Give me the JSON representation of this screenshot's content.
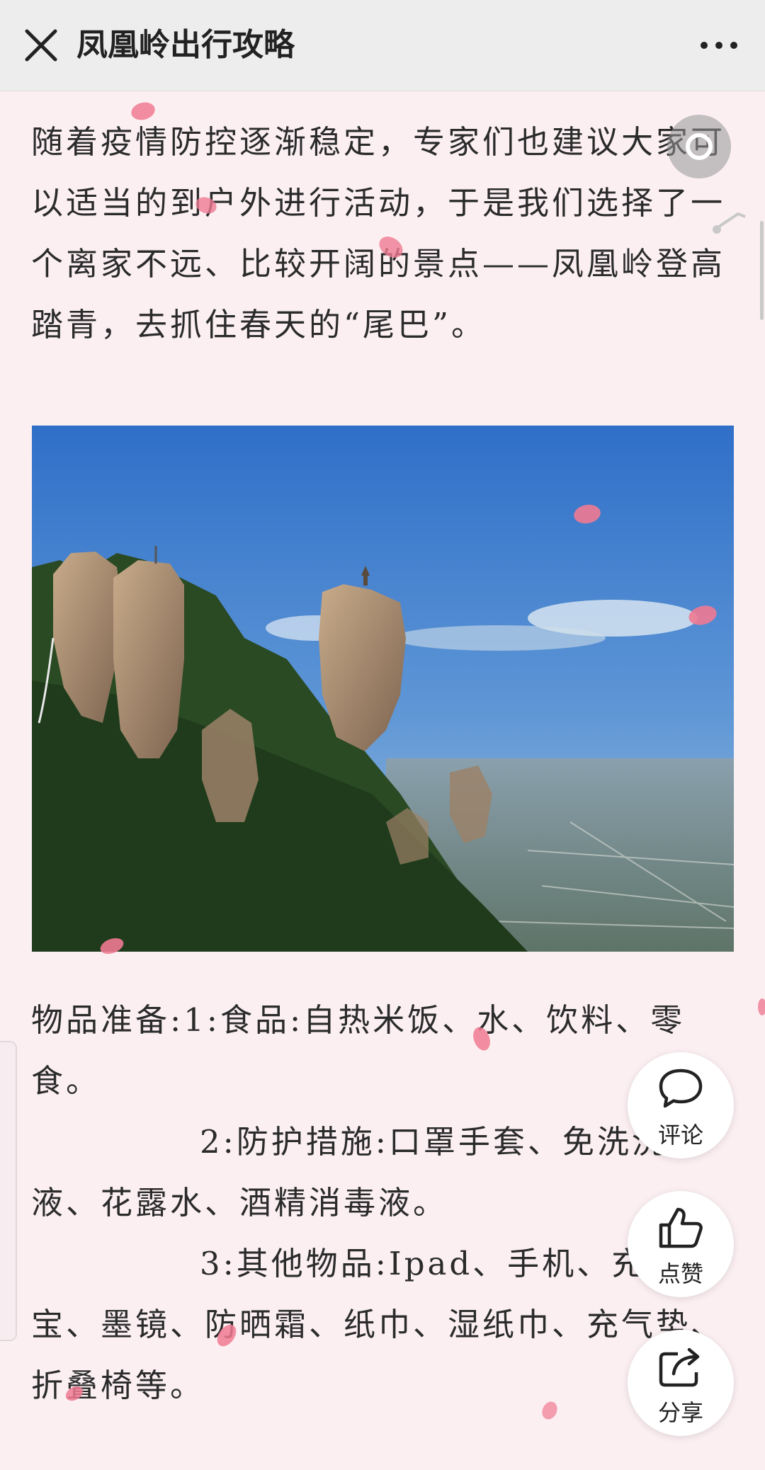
{
  "topbar": {
    "title": "凤凰岭出行攻略",
    "close_icon": "close-icon",
    "more_icon": "more-dots-icon"
  },
  "article": {
    "intro": "随着疫情防控逐渐稳定，专家们也建议大家可以适当的到户外进行活动，于是我们选择了一个离家不远、比较开阔的景点——凤凰岭登高踏青，去抓住春天的“尾巴”。",
    "items_text": "物品准备:1:食品:自热米饭、水、饮料、零食。\n             2:防护措施:口罩手套、免洗洗手液、花露水、酒精消毒液。\n             3:其他物品:Ipad、手机、充电宝、墨镜、防晒霜、纸巾、湿纸巾、充气垫、折叠椅等。"
  },
  "actions": {
    "comment_label": "评论",
    "like_label": "点赞",
    "share_label": "分享"
  },
  "icons": {
    "music": "music-disc-icon",
    "comment": "comment-bubble-icon",
    "like": "thumbs-up-icon",
    "share": "share-arrow-icon"
  },
  "colors": {
    "background": "#fbeff2",
    "topbar": "#ededed",
    "petal": "#f07a92"
  }
}
